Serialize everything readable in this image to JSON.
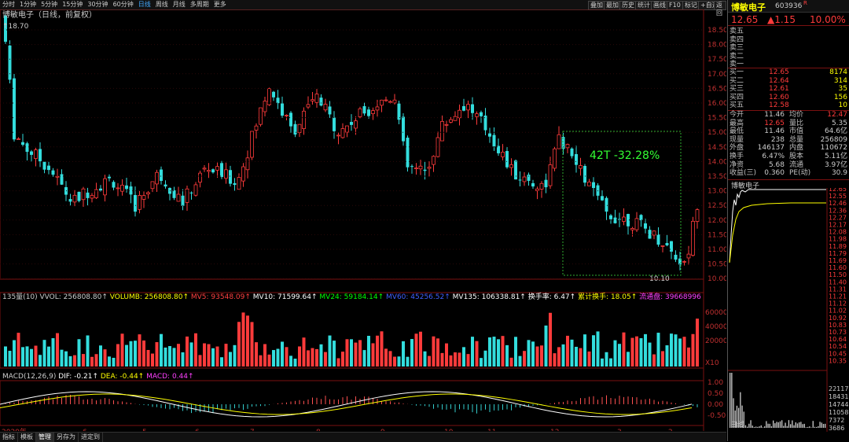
{
  "toolbar": {
    "periods": [
      "分时",
      "1分钟",
      "5分钟",
      "15分钟",
      "30分钟",
      "60分钟",
      "日线",
      "周线",
      "月线",
      "多周期",
      "更多"
    ],
    "active_period": "日线",
    "buttons": [
      "叠加",
      "最加",
      "历史",
      "统计",
      "画线",
      "F10",
      "标记",
      "+自选",
      "返回"
    ]
  },
  "chart_header": {
    "title": "博敏电子（日线，前复权）",
    "max_label": "18.70",
    "annotation": "42T  -32.28%",
    "low_label": "10.10"
  },
  "price_axis": [
    "18.50",
    "18.00",
    "17.50",
    "17.00",
    "16.50",
    "16.00",
    "15.50",
    "15.00",
    "14.50",
    "14.00",
    "13.50",
    "13.00",
    "12.50",
    "12.00",
    "11.50",
    "11.00",
    "10.50",
    "10.00"
  ],
  "volume_header": {
    "title": "135量(10)",
    "items": [
      {
        "text": "VVOL: 256808.80↑",
        "color": "#cccccc"
      },
      {
        "text": "VOLUMB: 256808.80↑",
        "color": "#ffff00"
      },
      {
        "text": "MV5: 93548.09↑",
        "color": "#ff4040"
      },
      {
        "text": "MV10: 71599.64↑",
        "color": "#ffffff"
      },
      {
        "text": "MV24: 59184.14↑",
        "color": "#00ff00"
      },
      {
        "text": "MV60: 45256.52↑",
        "color": "#4060ff"
      },
      {
        "text": "MV135: 106338.81↑",
        "color": "#ffffff"
      },
      {
        "text": "换手率: 6.47↑",
        "color": "#ffffff"
      },
      {
        "text": "累计换手: 18.05↑",
        "color": "#ffff00"
      },
      {
        "text": "流通盘: 39668996",
        "color": "#ff40ff"
      }
    ]
  },
  "volume_axis": [
    "60000",
    "40000",
    "20000",
    "X10"
  ],
  "macd_header": {
    "title": "MACD(12,26,9)",
    "items": [
      {
        "text": "DIF: -0.21↑",
        "color": "#ffffff"
      },
      {
        "text": "DEA: -0.44↑",
        "color": "#ffff00"
      },
      {
        "text": "MACD: 0.44↑",
        "color": "#ff40ff"
      }
    ]
  },
  "macd_axis": [
    "1.00",
    "0.50",
    "0.00",
    "-0.50"
  ],
  "date_axis": [
    "2020年",
    "6",
    "5",
    "6",
    "7",
    "8",
    "9",
    "10",
    "11",
    "12",
    "3",
    "2"
  ],
  "bottom_tabs": [
    "指标",
    "模板",
    "管理",
    "另存为",
    "进定到"
  ],
  "quote": {
    "name": "博敏电子",
    "code": "603936",
    "rank": "R",
    "price": "12.65",
    "change": "▲1.15",
    "pct": "10.00%",
    "sell_labels": [
      "卖五",
      "卖四",
      "卖三",
      "卖二",
      "卖一"
    ],
    "buy": [
      {
        "label": "买一",
        "price": "12.65",
        "vol": "8174"
      },
      {
        "label": "买二",
        "price": "12.64",
        "vol": "314"
      },
      {
        "label": "买三",
        "price": "12.61",
        "vol": "35"
      },
      {
        "label": "买四",
        "price": "12.60",
        "vol": "156"
      },
      {
        "label": "买五",
        "price": "12.58",
        "vol": "10"
      }
    ],
    "stats": [
      {
        "l1": "今开",
        "v1": "11.46",
        "l2": "均价",
        "v2": "12.47"
      },
      {
        "l1": "最高",
        "v1": "12.65",
        "l2": "量比",
        "v2": "5.35"
      },
      {
        "l1": "最低",
        "v1": "11.46",
        "l2": "市值",
        "v2": "64.6亿"
      },
      {
        "l1": "现量",
        "v1": "238",
        "l2": "总量",
        "v2": "256809"
      },
      {
        "l1": "外盘",
        "v1": "146137",
        "l2": "内盘",
        "v2": "110672"
      },
      {
        "l1": "换手",
        "v1": "6.47%",
        "l2": "股本",
        "v2": "5.11亿"
      },
      {
        "l1": "净资",
        "v1": "5.68",
        "l2": "流通",
        "v2": "3.97亿"
      },
      {
        "l1": "收益(三)",
        "v1": "0.360",
        "l2": "PE(动)",
        "v2": "30.9"
      }
    ],
    "mini_title": "博敏电子",
    "mini_price_axis": [
      "12.65",
      "12.55",
      "12.46",
      "12.36",
      "12.27",
      "12.17",
      "12.08",
      "11.98",
      "11.89",
      "11.79",
      "11.69",
      "11.60",
      "11.50",
      "11.40",
      "11.31",
      "11.21",
      "11.12",
      "11.02",
      "10.92",
      "10.83",
      "10.73",
      "10.64",
      "10.54",
      "10.45",
      "10.35"
    ],
    "mini_vol_axis": [
      "22117",
      "18431",
      "14744",
      "11058",
      "7372",
      "3686"
    ],
    "mini_tab": "日线"
  },
  "colors": {
    "up": "#ff3b3b",
    "down": "#33dddd",
    "ma": "#ffff00",
    "bg": "#000000"
  }
}
